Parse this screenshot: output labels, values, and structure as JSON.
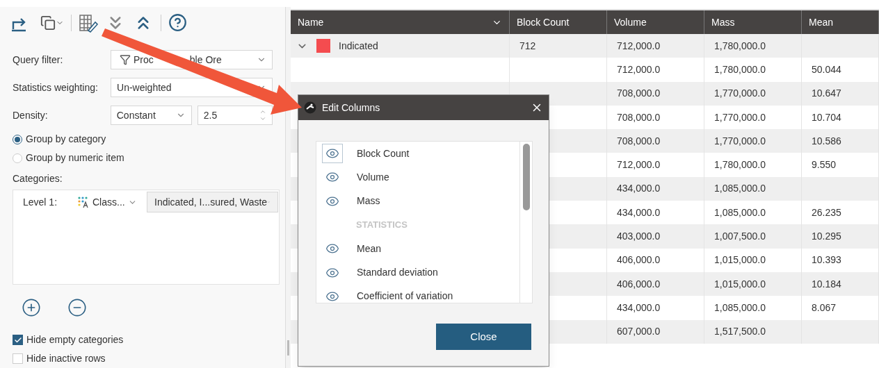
{
  "filters": {
    "query_filter": {
      "label": "Query filter:",
      "value_parts": [
        "Proc",
        "ble Ore"
      ]
    },
    "statistics_weighting": {
      "label": "Statistics weighting:",
      "value": "Un-weighted"
    },
    "density": {
      "label": "Density:",
      "mode": "Constant",
      "value": "2.5"
    }
  },
  "grouping": [
    {
      "label": "Group by category",
      "selected": true
    },
    {
      "label": "Group by numeric item",
      "selected": false
    }
  ],
  "categories": {
    "label": "Categories:",
    "levels": [
      {
        "label": "Level 1:",
        "column": "Class...",
        "values": "Indicated, I...sured, Waste"
      }
    ]
  },
  "options": [
    {
      "label": "Hide empty categories",
      "checked": true
    },
    {
      "label": "Hide inactive rows",
      "checked": false
    }
  ],
  "table": {
    "columns": [
      "Name",
      "Block Count",
      "Volume",
      "Mass",
      "Mean"
    ],
    "rows": [
      {
        "name": "Indicated",
        "color": "#f44c4f",
        "expanded": true,
        "block_count": "712",
        "volume": "712,000.0",
        "mass": "1,780,000.0"
      },
      {
        "volume": "712,000.0",
        "mass": "1,780,000.0",
        "mean": "50.044"
      },
      {
        "volume": "708,000.0",
        "mass": "1,770,000.0",
        "mean": "10.647"
      },
      {
        "volume": "708,000.0",
        "mass": "1,770,000.0",
        "mean": "10.704"
      },
      {
        "volume": "708,000.0",
        "mass": "1,770,000.0",
        "mean": "10.586"
      },
      {
        "volume": "712,000.0",
        "mass": "1,780,000.0",
        "mean": "9.550"
      },
      {
        "volume": "434,000.0",
        "mass": "1,085,000.0"
      },
      {
        "volume": "434,000.0",
        "mass": "1,085,000.0",
        "mean": "26.235"
      },
      {
        "volume": "403,000.0",
        "mass": "1,007,500.0",
        "mean": "10.295"
      },
      {
        "volume": "406,000.0",
        "mass": "1,015,000.0",
        "mean": "10.393"
      },
      {
        "volume": "406,000.0",
        "mass": "1,015,000.0",
        "mean": "10.184"
      },
      {
        "volume": "434,000.0",
        "mass": "1,085,000.0",
        "mean": "8.067"
      },
      {
        "volume": "607,000.0",
        "mass": "1,517,500.0"
      }
    ]
  },
  "dialog": {
    "title": "Edit Columns",
    "items": [
      {
        "kind": "column",
        "label": "Block Count",
        "focused": true
      },
      {
        "kind": "column",
        "label": "Volume",
        "focused": false
      },
      {
        "kind": "column",
        "label": "Mass",
        "focused": false
      },
      {
        "kind": "header",
        "label": "STATISTICS"
      },
      {
        "kind": "column",
        "label": "Mean",
        "focused": false
      },
      {
        "kind": "column",
        "label": "Standard deviation",
        "focused": false
      },
      {
        "kind": "column",
        "label": "Coefficient of variation",
        "focused": false
      }
    ],
    "button": "Close"
  }
}
